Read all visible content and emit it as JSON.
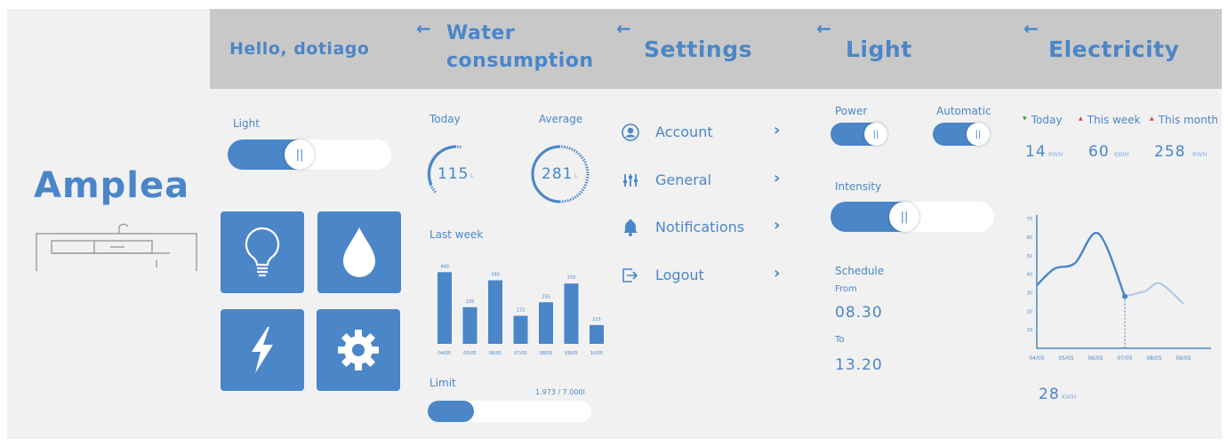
{
  "brand": {
    "name": "Amplea"
  },
  "home": {
    "greeting": "Hello, dotiago",
    "light_label": "Light",
    "light_level": 0.5,
    "tiles": [
      "bulb-icon",
      "drop-icon",
      "bolt-icon",
      "gear-icon"
    ]
  },
  "water": {
    "back": "←",
    "title_line1": "Water",
    "title_line2": "consumption",
    "today_label": "Today",
    "average_label": "Average",
    "today_value": "115",
    "average_value": "281",
    "unit": "L",
    "lastweek_label": "Last week",
    "bars": [
      {
        "day": "04/05",
        "value": 440
      },
      {
        "day": "05/05",
        "value": 225
      },
      {
        "day": "06/05",
        "value": 390
      },
      {
        "day": "07/05",
        "value": 172
      },
      {
        "day": "08/05",
        "value": 255
      },
      {
        "day": "09/05",
        "value": 370
      },
      {
        "day": "10/05",
        "value": 115
      }
    ],
    "limit_label": "Limit",
    "limit_text": "1.973 / 7.000l",
    "limit_fraction": 0.28
  },
  "settings": {
    "back": "←",
    "title": "Settings",
    "items": [
      {
        "label": "Account",
        "chevron": "›"
      },
      {
        "label": "General",
        "chevron": "›"
      },
      {
        "label": "Notifications",
        "chevron": "›"
      },
      {
        "label": "Logout",
        "chevron": "›"
      }
    ]
  },
  "light": {
    "back": "←",
    "title": "Light",
    "power_label": "Power",
    "automatic_label": "Automatic",
    "intensity_label": "Intensity",
    "intensity_level": 0.45,
    "schedule_label": "Schedule",
    "from_label": "From",
    "from_value": "08.30",
    "to_label": "To",
    "to_value": "13.20"
  },
  "electricity": {
    "back": "←",
    "title": "Electricity",
    "periods": [
      {
        "label": "Today",
        "value": "14",
        "unit": "KWH",
        "trend": "down",
        "trend_color": "#3aa33a"
      },
      {
        "label": "This week",
        "value": "60",
        "unit": "KWH",
        "trend": "up",
        "trend_color": "#d83a3a"
      },
      {
        "label": "This month",
        "value": "258",
        "unit": "KWH",
        "trend": "up",
        "trend_color": "#d83a3a"
      }
    ],
    "bottom_value": "28",
    "bottom_unit": "KWH"
  },
  "chart_data": {
    "type": "line",
    "x": [
      "04/05",
      "05/05",
      "06/05",
      "07/05",
      "08/05",
      "09/05"
    ],
    "yticks": [
      10,
      20,
      30,
      40,
      50,
      60,
      70
    ],
    "ylim": [
      0,
      72
    ],
    "series": [
      {
        "style": "solid",
        "points": [
          [
            0,
            34
          ],
          [
            0.6,
            43
          ],
          [
            1.3,
            46
          ],
          [
            2.1,
            62
          ],
          [
            3.0,
            28
          ]
        ]
      },
      {
        "style": "faded",
        "points": [
          [
            3.0,
            28
          ],
          [
            3.7,
            31
          ],
          [
            4.2,
            35
          ],
          [
            5.0,
            24
          ]
        ]
      }
    ],
    "marker_x": 3.0
  },
  "colors": {
    "accent": "#4a86c8",
    "header": "#c8c8c8",
    "panel": "#f1f1f1",
    "faded": "#a9c6e6"
  }
}
